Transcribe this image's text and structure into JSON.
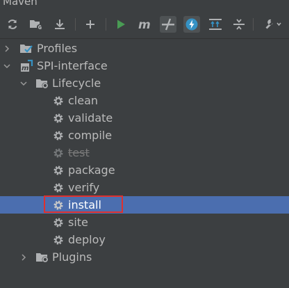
{
  "window": {
    "title": "Maven"
  },
  "toolbar": {
    "buttons": [
      {
        "icon": "reload-icon",
        "tooltip": ""
      },
      {
        "icon": "generate-sources-icon"
      },
      {
        "icon": "download-icon"
      },
      {
        "icon": "add-icon"
      },
      {
        "icon": "run-icon"
      },
      {
        "icon": "maven-goal-icon",
        "text": "m"
      },
      {
        "icon": "toggle-offline-icon"
      },
      {
        "icon": "skip-tests-icon"
      },
      {
        "icon": "show-dependencies-icon"
      },
      {
        "icon": "collapse-all-icon"
      },
      {
        "icon": "settings-wrench-icon"
      }
    ]
  },
  "tree": {
    "profiles": "Profiles",
    "project": "SPI-interface",
    "lifecycle": "Lifecycle",
    "goals": [
      "clean",
      "validate",
      "compile",
      "test",
      "package",
      "verify",
      "install",
      "site",
      "deploy"
    ],
    "plugins": "Plugins",
    "selected_goal": "install",
    "disabled_goal": "test"
  },
  "colors": {
    "background": "#3c3f41",
    "selection": "#4b6eaf",
    "highlight": "#e0302d",
    "run_green": "#499c54",
    "accent_blue": "#3592c4"
  }
}
